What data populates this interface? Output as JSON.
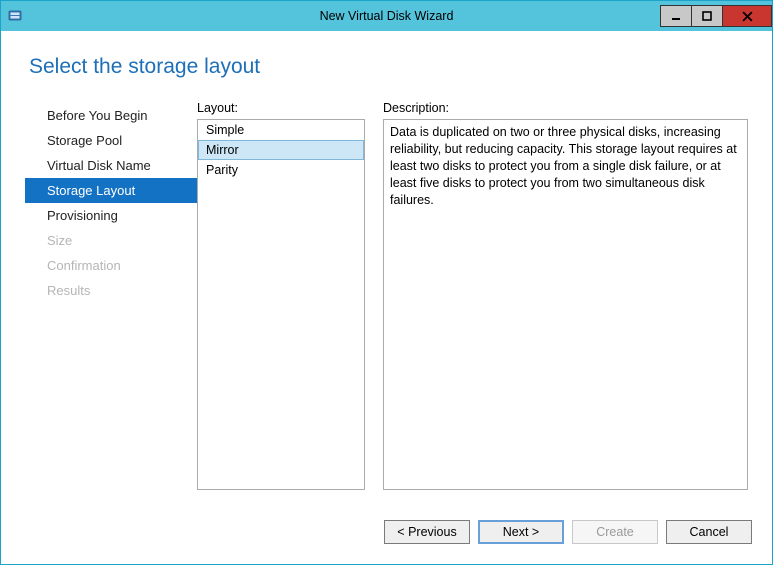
{
  "window": {
    "title": "New Virtual Disk Wizard"
  },
  "page": {
    "title": "Select the storage layout"
  },
  "steps": [
    {
      "label": "Before You Begin",
      "state": "normal"
    },
    {
      "label": "Storage Pool",
      "state": "normal"
    },
    {
      "label": "Virtual Disk Name",
      "state": "normal"
    },
    {
      "label": "Storage Layout",
      "state": "active"
    },
    {
      "label": "Provisioning",
      "state": "normal"
    },
    {
      "label": "Size",
      "state": "disabled"
    },
    {
      "label": "Confirmation",
      "state": "disabled"
    },
    {
      "label": "Results",
      "state": "disabled"
    }
  ],
  "labels": {
    "layout": "Layout:",
    "description": "Description:"
  },
  "layouts": [
    {
      "name": "Simple",
      "selected": false
    },
    {
      "name": "Mirror",
      "selected": true
    },
    {
      "name": "Parity",
      "selected": false
    }
  ],
  "description_text": "Data is duplicated on two or three physical disks, increasing reliability, but reducing capacity. This storage layout requires at least two disks to protect you from a single disk failure, or at least five disks to protect you from two simultaneous disk failures.",
  "buttons": {
    "previous": "< Previous",
    "next": "Next >",
    "create": "Create",
    "cancel": "Cancel"
  }
}
